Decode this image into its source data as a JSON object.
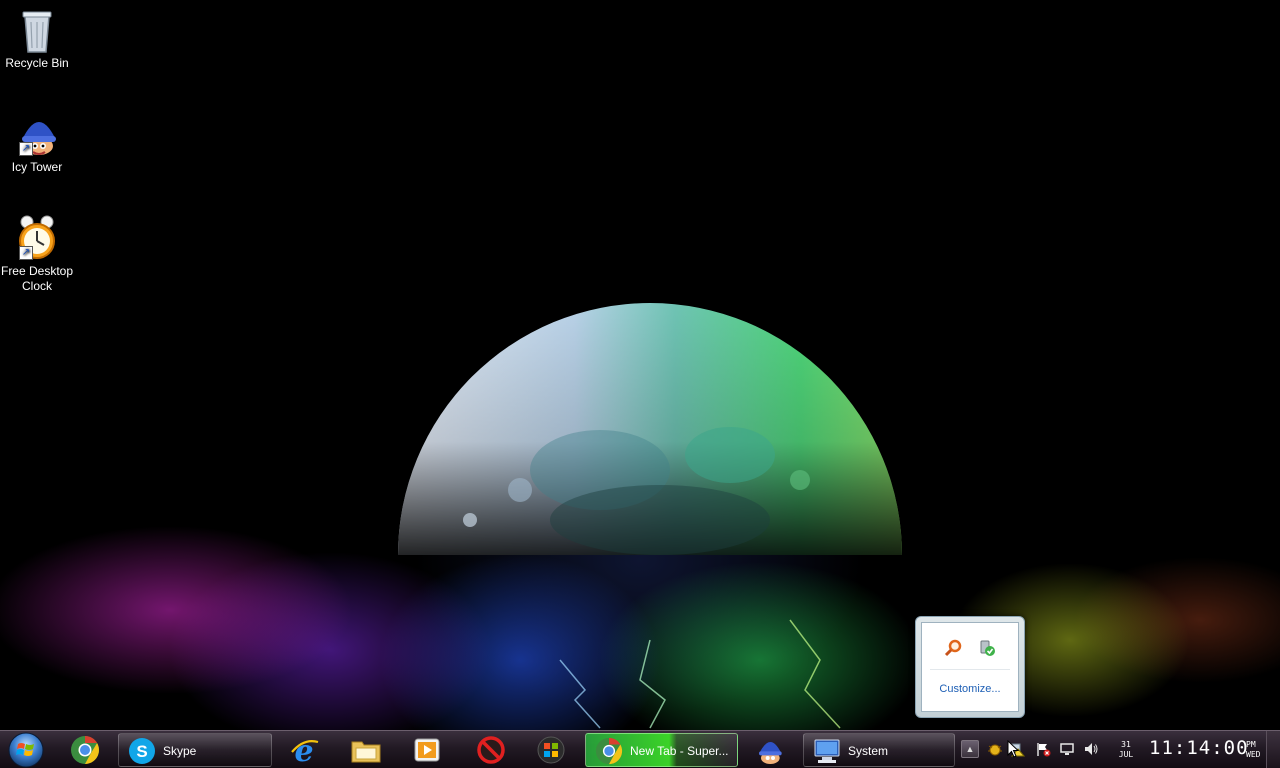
{
  "desktop": {
    "icons": [
      {
        "label": "Recycle Bin",
        "icon": "recycle-bin-icon"
      },
      {
        "label": "Icy Tower",
        "icon": "icy-tower-icon"
      },
      {
        "label": "Free Desktop Clock",
        "icon": "alarm-clock-icon"
      }
    ]
  },
  "tray_popup": {
    "customize_label": "Customize...",
    "icons": [
      "magnifier-icon",
      "safely-remove-hardware-icon"
    ]
  },
  "taskbar": {
    "start": {
      "icon": "windows-start-orb-icon"
    },
    "quick_launch": [
      {
        "icon": "chrome-icon"
      }
    ],
    "buttons": [
      {
        "label": "Skype",
        "icon": "skype-icon",
        "active": false
      },
      {
        "label": "New Tab - Super...",
        "icon": "chrome-icon",
        "active": true
      },
      {
        "label": "System",
        "icon": "system-computer-icon",
        "active": false
      }
    ],
    "pinned": [
      "internet-explorer-icon",
      "folder-icon",
      "media-player-icon",
      "no-entry-icon",
      "windows-flag-icon",
      "icy-tower-icon"
    ],
    "tray": {
      "chevron": "show-hidden-icons",
      "icons": [
        "bug-icon",
        "network-warning-icon",
        "action-center-flag-icon",
        "display-icon",
        "volume-icon"
      ],
      "clock": {
        "date_day": "31",
        "date_month": "JUL",
        "time": "11:14:00",
        "ampm": "PM",
        "weekday": "WED"
      }
    }
  },
  "colors": {
    "taskbar_top": "#3a2f3d",
    "taskbar_bottom": "#120b12",
    "active_task": "#3cdc28",
    "link_blue": "#1e5fb5"
  }
}
